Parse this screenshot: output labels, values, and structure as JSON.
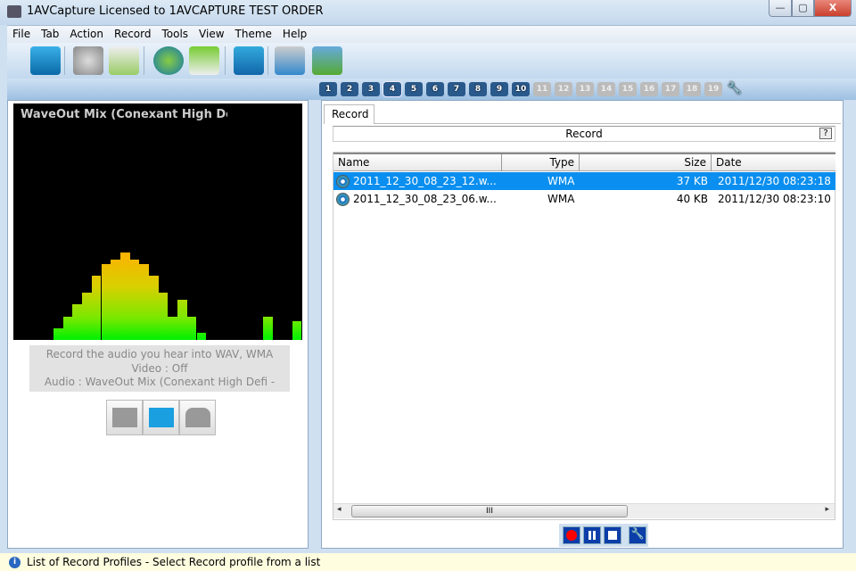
{
  "window": {
    "title": "1AVCapture Licensed to 1AVCAPTURE TEST ORDER",
    "minimize": "—",
    "maximize": "▢",
    "close": "X"
  },
  "menu": [
    "File",
    "Tab",
    "Action",
    "Record",
    "Tools",
    "View",
    "Theme",
    "Help"
  ],
  "toolbar_icons": [
    "help-book-icon",
    "settings-gears-icon",
    "manual-book-icon",
    "upload-globe-icon",
    "email-icon",
    "screen-profile-icon",
    "media-convert-icon",
    "output-tray-icon"
  ],
  "profile_tabs": {
    "enabled": [
      "1",
      "2",
      "3",
      "4",
      "5",
      "6",
      "7",
      "8",
      "9",
      "10"
    ],
    "disabled": [
      "11",
      "12",
      "13",
      "14",
      "15",
      "16",
      "17",
      "18",
      "19"
    ],
    "active": "4",
    "wrench_icon": "wrench-icon"
  },
  "visualizer": {
    "label": "WaveOut Mix (Conexant High Definition Audio)",
    "levels_percent": [
      5,
      10,
      15,
      20,
      27,
      32,
      34,
      37,
      34,
      32,
      27,
      20,
      10,
      17,
      10,
      3,
      0,
      0,
      0,
      0,
      0,
      0,
      10,
      0,
      0,
      8
    ],
    "colors": {
      "low": "#00f000",
      "mid": "#d8d000",
      "high": "#ffb000"
    }
  },
  "info": {
    "line1": "Record the audio you hear into WAV, WMA",
    "line2": "Video : Off",
    "line3": "Audio : WaveOut Mix (Conexant High Defi -"
  },
  "right": {
    "tab": "Record",
    "header": "Record",
    "help": "?",
    "columns": [
      "Name",
      "Type",
      "Size",
      "Date"
    ],
    "rows": [
      {
        "name": "2011_12_30_08_23_12.w...",
        "type": "WMA",
        "size": "37 KB",
        "date": "2011/12/30 08:23:18",
        "selected": true
      },
      {
        "name": "2011_12_30_08_23_06.w...",
        "type": "WMA",
        "size": "40 KB",
        "date": "2011/12/30 08:23:10",
        "selected": false
      }
    ],
    "scroll_grip": "III",
    "scroll_left": "◂",
    "scroll_right": "▸"
  },
  "status": {
    "text": "List of Record Profiles - Select Record profile from a list",
    "icon": "i"
  }
}
